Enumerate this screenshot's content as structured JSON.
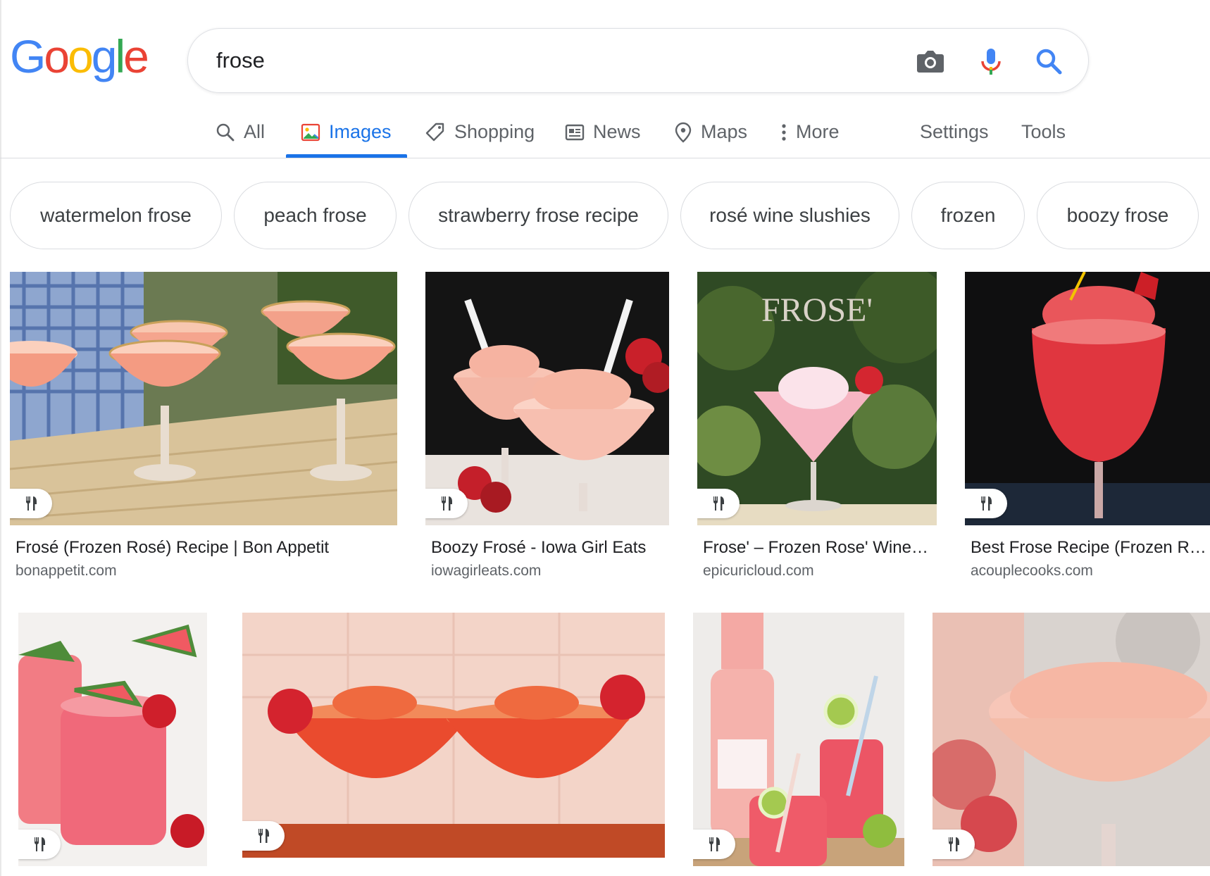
{
  "logo": {
    "text": "Google"
  },
  "search": {
    "query": "frose"
  },
  "tabs": [
    {
      "label": "All",
      "icon": "search-icon"
    },
    {
      "label": "Images",
      "icon": "image-icon"
    },
    {
      "label": "Shopping",
      "icon": "tag-icon"
    },
    {
      "label": "News",
      "icon": "newspaper-icon"
    },
    {
      "label": "Maps",
      "icon": "map-pin-icon"
    },
    {
      "label": "More",
      "icon": "vertical-dots-icon"
    },
    {
      "label": "Settings"
    },
    {
      "label": "Tools"
    }
  ],
  "active_tab": "Images",
  "chips": [
    "watermelon frose",
    "peach frose",
    "strawberry frose recipe",
    "rosé wine slushies",
    "frozen",
    "boozy frose"
  ],
  "results": [
    {
      "title": "Frosé (Frozen Rosé) Recipe | Bon Appetit",
      "domain": "bonappetit.com",
      "badge_icon": "fork-knife-icon"
    },
    {
      "title": "Boozy Frosé - Iowa Girl Eats",
      "domain": "iowagirleats.com",
      "badge_icon": "fork-knife-icon"
    },
    {
      "title": "Frose' – Frozen Rose' Wine ...",
      "domain": "epicuricloud.com",
      "badge_icon": "fork-knife-icon",
      "image_text": "FROSE'"
    },
    {
      "title": "Best Frose Recipe (Frozen Ros...",
      "domain": "acouplecooks.com",
      "badge_icon": "fork-knife-icon"
    },
    {
      "badge_icon": "fork-knife-icon"
    },
    {
      "badge_icon": "fork-knife-icon"
    },
    {
      "badge_icon": "fork-knife-icon"
    },
    {
      "badge_icon": "fork-knife-icon"
    }
  ],
  "colors": {
    "google_blue": "#4285F4",
    "google_red": "#EA4335",
    "google_yellow": "#FBBC05",
    "google_green": "#34A853",
    "active_tab": "#1a73e8"
  }
}
